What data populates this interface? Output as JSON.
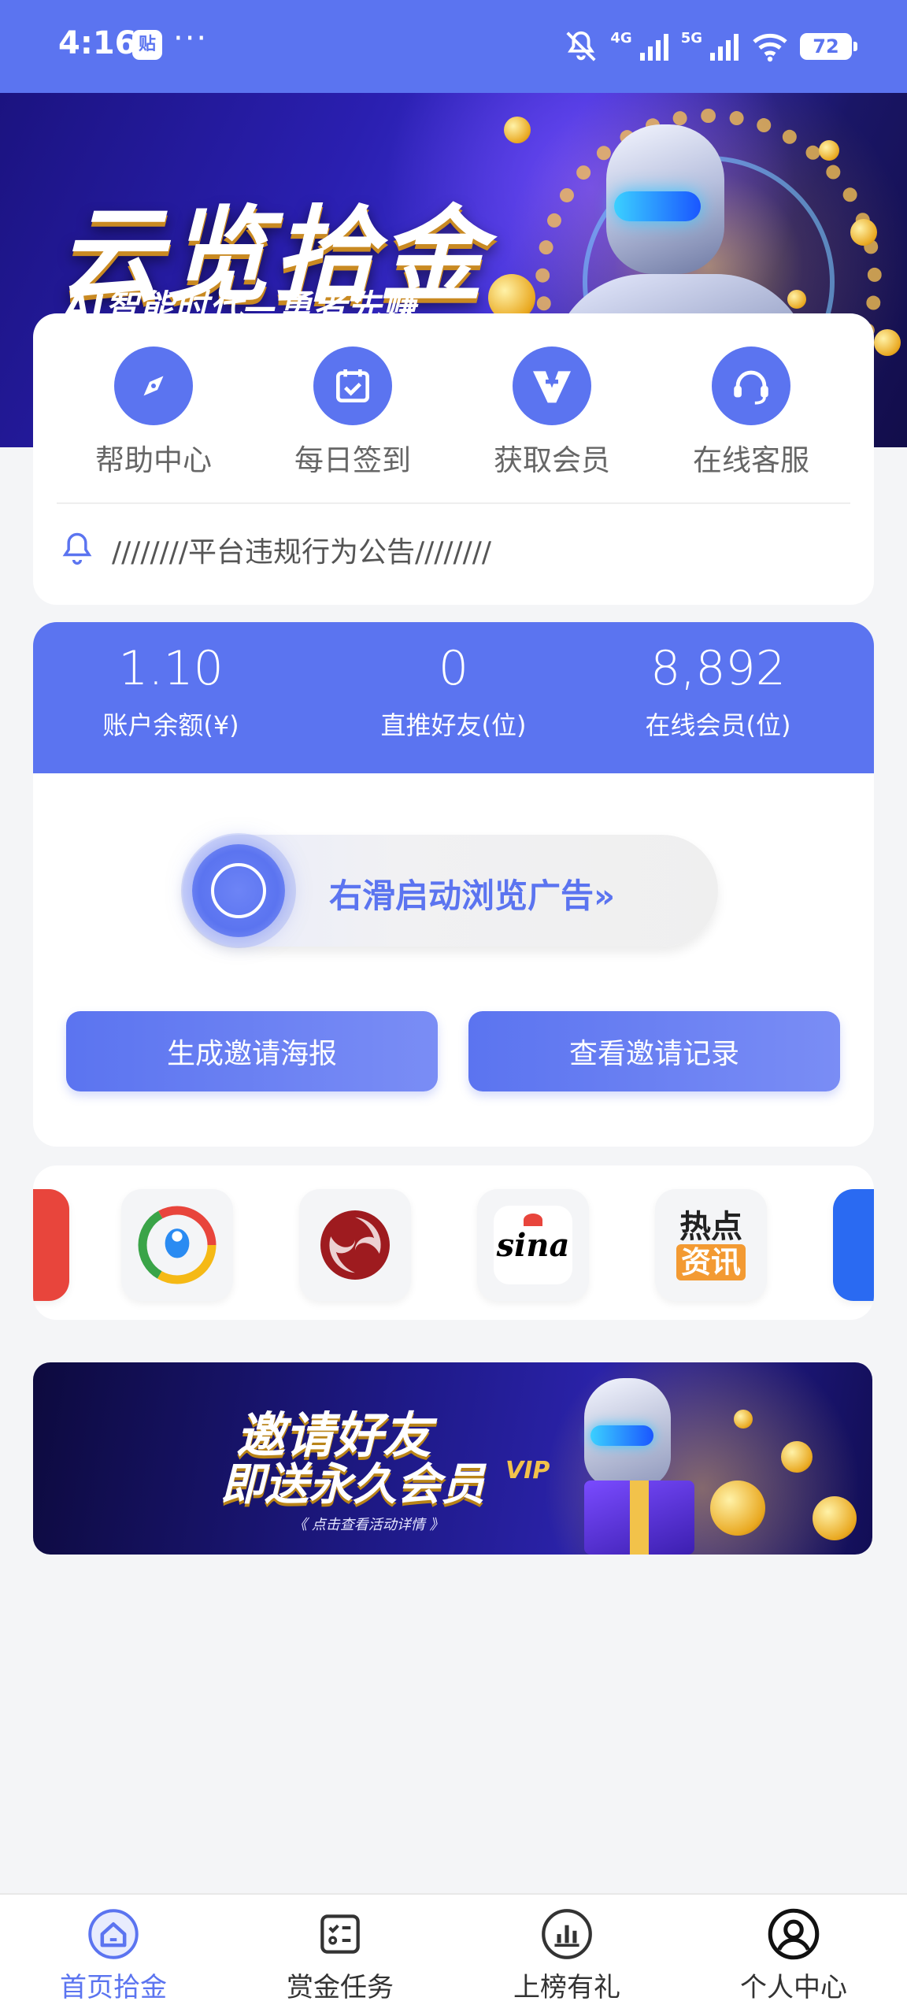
{
  "status_bar": {
    "time": "4:16",
    "app_badge": "贴",
    "more": "···",
    "network_1": "4G",
    "network_2": "5G",
    "battery": "72"
  },
  "hero": {
    "title": "云览拾金",
    "subtitle": "AI智能时代—勇者先赚"
  },
  "quick_menu": [
    {
      "label": "帮助中心",
      "icon": "compass-icon"
    },
    {
      "label": "每日签到",
      "icon": "calendar-check-icon"
    },
    {
      "label": "获取会员",
      "icon": "vip-v-icon"
    },
    {
      "label": "在线客服",
      "icon": "headset-icon"
    }
  ],
  "notice": {
    "icon": "bell-icon",
    "text": "////////平台违规行为公告////////"
  },
  "stats": [
    {
      "value": "1.10",
      "label": "账户余额(¥)"
    },
    {
      "value": "0",
      "label": "直推好友(位)"
    },
    {
      "value": "8,892",
      "label": "在线会员(位)"
    }
  ],
  "slider": {
    "text": "右滑启动浏览广告»"
  },
  "actions": {
    "poster": "生成邀请海报",
    "records": "查看邀请记录"
  },
  "apps": [
    {
      "name": "partial-red-app"
    },
    {
      "name": "tencent-news"
    },
    {
      "name": "phoenix-news"
    },
    {
      "name": "sina"
    },
    {
      "name": "hot-news",
      "label_1": "热点",
      "label_2": "资讯"
    },
    {
      "name": "partial-blue-app"
    }
  ],
  "sina_logo_text": "sina",
  "invite_banner": {
    "title_line_1": "邀请好友",
    "title_line_2": "即送永久会员",
    "caption": "《 点击查看活动详情 》",
    "badge": "VIP"
  },
  "bottom_nav": [
    {
      "label": "首页拾金",
      "icon": "home-icon",
      "active": true
    },
    {
      "label": "赏金任务",
      "icon": "task-list-icon",
      "active": false
    },
    {
      "label": "上榜有礼",
      "icon": "ranking-chart-icon",
      "active": false
    },
    {
      "label": "个人中心",
      "icon": "user-icon",
      "active": false
    }
  ],
  "colors": {
    "primary": "#5b74f0",
    "background": "#f4f5f7",
    "card": "#ffffff"
  }
}
